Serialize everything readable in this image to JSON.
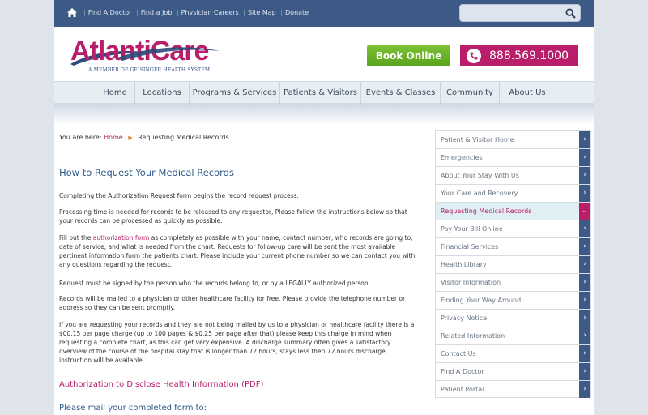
{
  "topbar": {
    "links": [
      "Find A Doctor",
      "Find a Job",
      "Physician Careers",
      "Site Map",
      "Donate"
    ],
    "search_placeholder": ""
  },
  "header": {
    "logo_text": "AtlantiCare",
    "logo_tagline": "A MEMBER OF GEISINGER HEALTH SYSTEM",
    "book_online": "Book Online",
    "phone": "888.569.1000"
  },
  "nav": {
    "items": [
      "Home",
      "Locations",
      "Programs & Services",
      "Patients & Visitors",
      "Events & Classes",
      "Community",
      "About Us"
    ]
  },
  "breadcrumb": {
    "prefix": "You are here:",
    "home": "Home",
    "current": "Requesting Medical Records"
  },
  "main": {
    "title": "How to Request Your Medical Records",
    "p1": "Completing the Authorization Request form begins the record request process.",
    "p2": "Processing time is needed for records to be released to any requestor, Please follow the instructions below so that your records can be processed as quickly as possible.",
    "p3_before": "Fill out the ",
    "p3_link": "authorization form",
    "p3_after": " as completely as possible with your name, contact number, who records are going to, date of service, and what is needed from the chart. Requests for follow-up care will be sent the most available pertinent information form the patients chart. Please include your current phone number so we can contact you with any questions regarding the request.",
    "p4": "Request must be signed by the person who the records belong to, or by a LEGALLY authorized person.",
    "p5": "Records will be mailed to a physician or other healthcare facility for free. Please provide the telephone number or address so they can be sent promptly.",
    "p6": "If you are requesting your records and they are not being mailed by us to a physician or healthcare facility there is a $00.15 per page charge (up to 100 pages & $0.25 per page after that) please keep this charge in mind when requesting a complete chart, as this can get very expensive. A discharge summary often gives a satisfactory overview of the course of the hospital stay that is longer than 72 hours, stays less then 72 hours discharge instruction will be available.",
    "auth_link": "Authorization to Disclose Health Information (PDF)",
    "mail_heading": "Please mail your completed form to:"
  },
  "sidebar": {
    "items": [
      {
        "label": "Patient & Visitor Home",
        "arrow": "›"
      },
      {
        "label": "Emergencies",
        "arrow": "›"
      },
      {
        "label": "About Your Stay With Us",
        "arrow": "›"
      },
      {
        "label": "Your Care and Recovery",
        "arrow": "›"
      },
      {
        "label": "Requesting Medical Records",
        "arrow": "⌄"
      },
      {
        "label": "Pay Your Bill Online",
        "arrow": "›"
      },
      {
        "label": "Financial Services",
        "arrow": "›"
      },
      {
        "label": "Health Library",
        "arrow": "›"
      },
      {
        "label": "Visitor Information",
        "arrow": "›"
      },
      {
        "label": "Finding Your Way Around",
        "arrow": "›"
      },
      {
        "label": "Privacy Notice",
        "arrow": "›"
      },
      {
        "label": "Related Information",
        "arrow": "›"
      },
      {
        "label": "Contact Us",
        "arrow": "›"
      },
      {
        "label": "Find A Doctor",
        "arrow": "›"
      },
      {
        "label": "Patient Portal",
        "arrow": "›"
      }
    ],
    "active_index": 4
  },
  "colors": {
    "brand_blue": "#3d5a86",
    "brand_magenta": "#b81e6a",
    "book_green": "#6cb22a"
  }
}
